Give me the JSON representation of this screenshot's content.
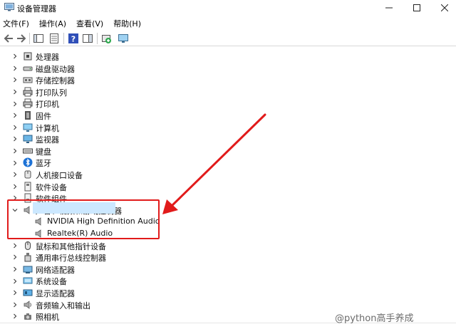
{
  "window": {
    "title": "设备管理器",
    "min_icon": "minimize-icon",
    "max_icon": "maximize-icon",
    "close_icon": "close-icon"
  },
  "menu": [
    "文件(F)",
    "操作(A)",
    "查看(V)",
    "帮助(H)"
  ],
  "toolbar": [
    "back-arrow-icon",
    "forward-arrow-icon",
    "show-hide-tree-icon",
    "properties-icon",
    "help-icon",
    "action-pane-icon",
    "update-driver-icon",
    "monitor-icon"
  ],
  "tree": {
    "items": [
      {
        "label": "处理器",
        "icon": "processor-icon",
        "expanded": false
      },
      {
        "label": "磁盘驱动器",
        "icon": "disk-drive-icon",
        "expanded": false
      },
      {
        "label": "存储控制器",
        "icon": "storage-controller-icon",
        "expanded": false
      },
      {
        "label": "打印队列",
        "icon": "print-queue-icon",
        "expanded": false
      },
      {
        "label": "打印机",
        "icon": "printer-icon",
        "expanded": false
      },
      {
        "label": "固件",
        "icon": "firmware-icon",
        "expanded": false
      },
      {
        "label": "计算机",
        "icon": "computer-icon",
        "expanded": false
      },
      {
        "label": "监视器",
        "icon": "monitor-icon",
        "expanded": false
      },
      {
        "label": "键盘",
        "icon": "keyboard-icon",
        "expanded": false
      },
      {
        "label": "蓝牙",
        "icon": "bluetooth-icon",
        "expanded": false
      },
      {
        "label": "人机接口设备",
        "icon": "hid-icon",
        "expanded": false
      },
      {
        "label": "软件设备",
        "icon": "software-device-icon",
        "expanded": false
      },
      {
        "label": "软件组件",
        "icon": "software-component-icon",
        "expanded": false
      },
      {
        "label": "声音、视频和游戏控制器",
        "icon": "speaker-icon",
        "expanded": true,
        "children": [
          {
            "label": "NVIDIA High Definition Audio",
            "icon": "speaker-icon"
          },
          {
            "label": "Realtek(R) Audio",
            "icon": "speaker-icon"
          }
        ]
      },
      {
        "label": "鼠标和其他指针设备",
        "icon": "mouse-icon",
        "expanded": false
      },
      {
        "label": "通用串行总线控制器",
        "icon": "usb-icon",
        "expanded": false
      },
      {
        "label": "网络适配器",
        "icon": "network-adapter-icon",
        "expanded": false
      },
      {
        "label": "系统设备",
        "icon": "system-device-icon",
        "expanded": false
      },
      {
        "label": "显示适配器",
        "icon": "display-adapter-icon",
        "expanded": false
      },
      {
        "label": "音频输入和输出",
        "icon": "audio-io-icon",
        "expanded": false
      },
      {
        "label": "照相机",
        "icon": "camera-icon",
        "expanded": false
      }
    ]
  },
  "watermark": "@python高手养成",
  "colors": {
    "highlight": "#e11b1b",
    "selection": "#cce8ff",
    "accent": "#0078d4"
  }
}
